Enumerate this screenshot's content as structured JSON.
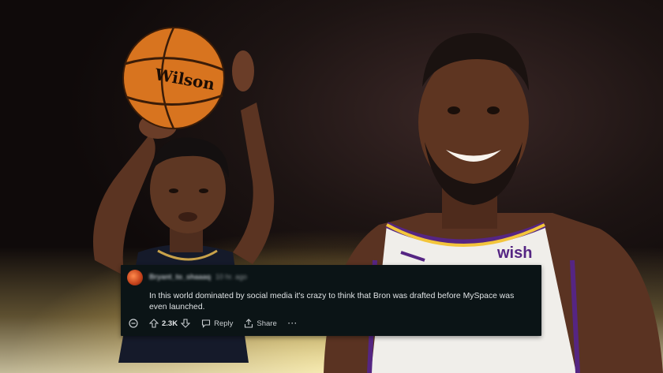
{
  "scene": {
    "background_color": "#120d0c",
    "glow_color": "#f5dc8a"
  },
  "ball": {
    "brand": "Wilson",
    "color": "#d8741f"
  },
  "jersey_right": {
    "sponsor": "wish",
    "trim_color": "#f3c53b",
    "accent_color": "#552583"
  },
  "comment": {
    "username": "Bryant_to_shaaaq",
    "time": "10 hr. ago",
    "text": "In this world dominated by social media it's crazy to think that Bron was drafted before MySpace was even launched.",
    "score": "2.3K",
    "reply_label": "Reply",
    "share_label": "Share",
    "more_label": "···",
    "icons": {
      "collapse": "collapse-icon",
      "upvote": "upvote-icon",
      "downvote": "downvote-icon",
      "reply": "reply-icon",
      "share": "share-icon",
      "more": "more-icon"
    }
  }
}
